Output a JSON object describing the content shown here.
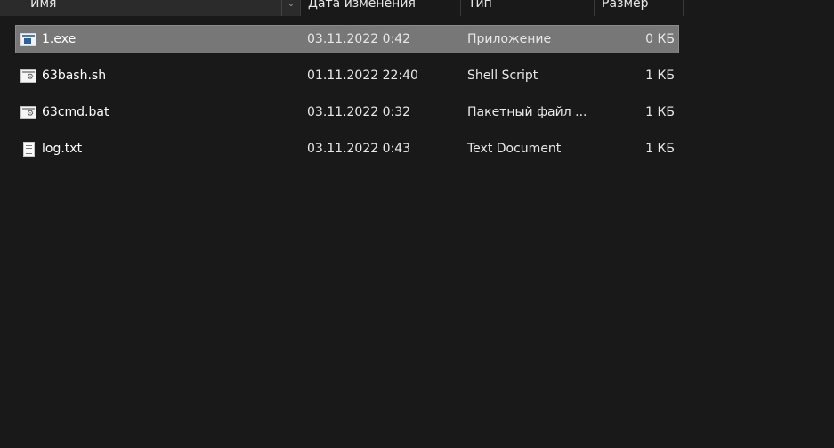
{
  "columns": {
    "name": "Имя",
    "date": "Дата изменения",
    "type": "Тип",
    "size": "Размер"
  },
  "files": [
    {
      "name": "1.exe",
      "date": "03.11.2022 0:42",
      "type": "Приложение",
      "size": "0 КБ",
      "icon": "application-icon",
      "selected": true
    },
    {
      "name": "63bash.sh",
      "date": "01.11.2022 22:40",
      "type": "Shell Script",
      "size": "1 КБ",
      "icon": "script-icon",
      "selected": false
    },
    {
      "name": "63cmd.bat",
      "date": "03.11.2022 0:32",
      "type": "Пакетный файл ...",
      "size": "1 КБ",
      "icon": "script-icon",
      "selected": false
    },
    {
      "name": "log.txt",
      "date": "03.11.2022 0:43",
      "type": "Text Document",
      "size": "1 КБ",
      "icon": "text-document-icon",
      "selected": false
    }
  ],
  "colors": {
    "background": "#191919",
    "selection": "#777777",
    "header": "#2b2b2b"
  }
}
